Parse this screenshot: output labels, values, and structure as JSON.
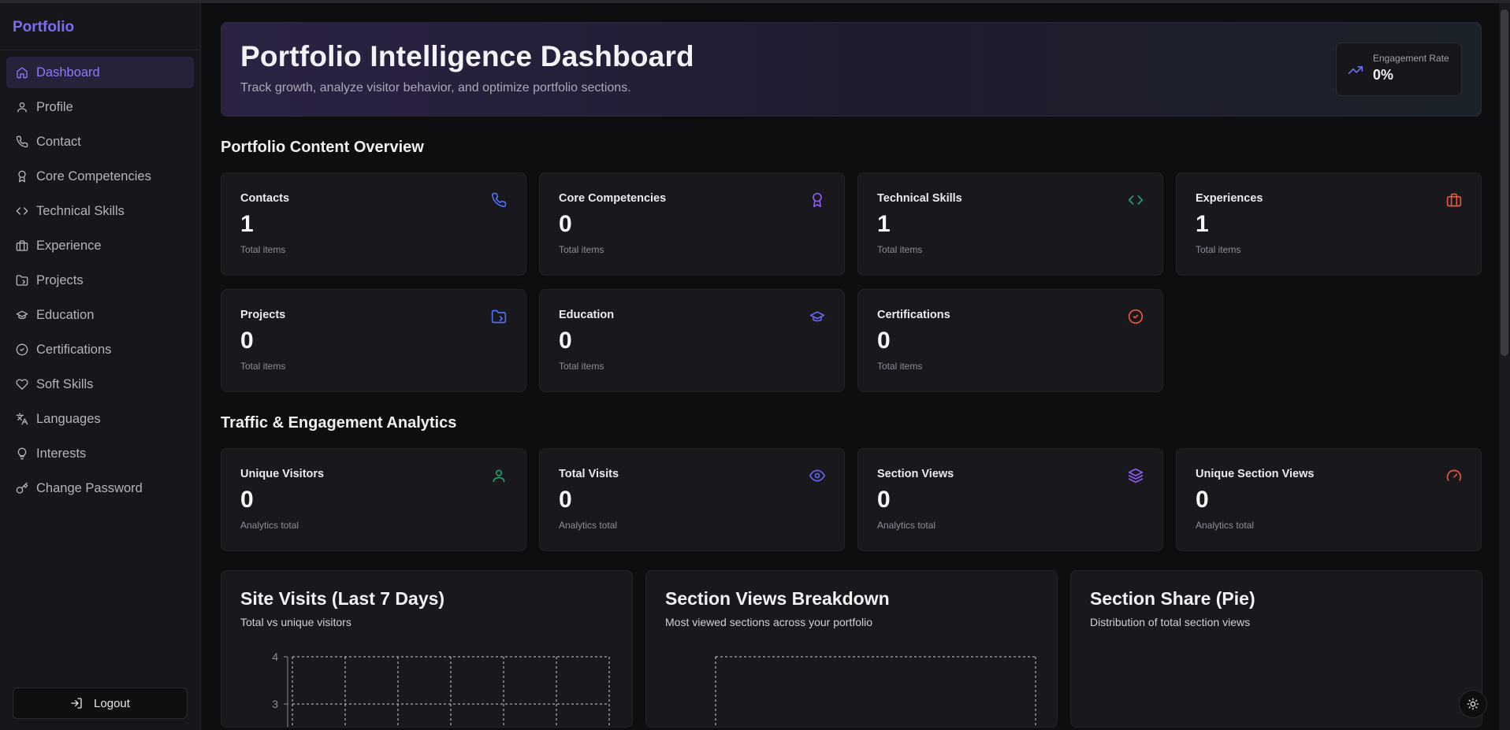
{
  "app": {
    "brand": "Portfolio"
  },
  "sidebar": {
    "items": [
      {
        "label": "Dashboard",
        "icon": "home-icon",
        "active": true
      },
      {
        "label": "Profile",
        "icon": "user-icon"
      },
      {
        "label": "Contact",
        "icon": "phone-icon"
      },
      {
        "label": "Core Competencies",
        "icon": "award-icon"
      },
      {
        "label": "Technical Skills",
        "icon": "code-icon"
      },
      {
        "label": "Experience",
        "icon": "briefcase-icon"
      },
      {
        "label": "Projects",
        "icon": "folder-icon"
      },
      {
        "label": "Education",
        "icon": "graduation-cap-icon"
      },
      {
        "label": "Certifications",
        "icon": "check-circle-icon"
      },
      {
        "label": "Soft Skills",
        "icon": "heart-icon"
      },
      {
        "label": "Languages",
        "icon": "languages-icon"
      },
      {
        "label": "Interests",
        "icon": "lightbulb-icon"
      },
      {
        "label": "Change Password",
        "icon": "key-icon"
      }
    ],
    "logout_label": "Logout"
  },
  "hero": {
    "title": "Portfolio Intelligence Dashboard",
    "subtitle": "Track growth, analyze visitor behavior, and optimize portfolio sections.",
    "engagement_label": "Engagement Rate",
    "engagement_value": "0%"
  },
  "content_overview": {
    "title": "Portfolio Content Overview",
    "cards": [
      {
        "title": "Contacts",
        "value": "1",
        "sub": "Total items",
        "icon": "phone-icon",
        "color": "#4f6df5"
      },
      {
        "title": "Core Competencies",
        "value": "0",
        "sub": "Total items",
        "icon": "award-icon",
        "color": "#8b5cf6"
      },
      {
        "title": "Technical Skills",
        "value": "1",
        "sub": "Total items",
        "icon": "code-icon",
        "color": "#22a06b"
      },
      {
        "title": "Experiences",
        "value": "1",
        "sub": "Total items",
        "icon": "briefcase-icon",
        "color": "#e8563f"
      },
      {
        "title": "Projects",
        "value": "0",
        "sub": "Total items",
        "icon": "folder-icon",
        "color": "#4f6df5"
      },
      {
        "title": "Education",
        "value": "0",
        "sub": "Total items",
        "icon": "graduation-cap-icon",
        "color": "#6366f1"
      },
      {
        "title": "Certifications",
        "value": "0",
        "sub": "Total items",
        "icon": "check-circle-icon",
        "color": "#e8563f"
      }
    ]
  },
  "analytics": {
    "title": "Traffic & Engagement Analytics",
    "cards": [
      {
        "title": "Unique Visitors",
        "value": "0",
        "sub": "Analytics total",
        "icon": "user-icon",
        "color": "#22a06b"
      },
      {
        "title": "Total Visits",
        "value": "0",
        "sub": "Analytics total",
        "icon": "eye-icon",
        "color": "#6366f1"
      },
      {
        "title": "Section Views",
        "value": "0",
        "sub": "Analytics total",
        "icon": "layers-icon",
        "color": "#8b5cf6"
      },
      {
        "title": "Unique Section Views",
        "value": "0",
        "sub": "Analytics total",
        "icon": "gauge-icon",
        "color": "#e8563f"
      }
    ]
  },
  "charts": [
    {
      "title": "Site Visits (Last 7 Days)",
      "subtitle": "Total vs unique visitors"
    },
    {
      "title": "Section Views Breakdown",
      "subtitle": "Most viewed sections across your portfolio"
    },
    {
      "title": "Section Share (Pie)",
      "subtitle": "Distribution of total section views"
    }
  ],
  "chart_data": [
    {
      "type": "line",
      "ytick_labels": [
        "4",
        "3"
      ],
      "grid": true
    },
    {
      "type": "bar",
      "grid": true
    },
    {
      "type": "pie"
    }
  ],
  "colors": {
    "accent": "#7c6cf0",
    "background": "#0e0e11",
    "card": "#18181d"
  }
}
